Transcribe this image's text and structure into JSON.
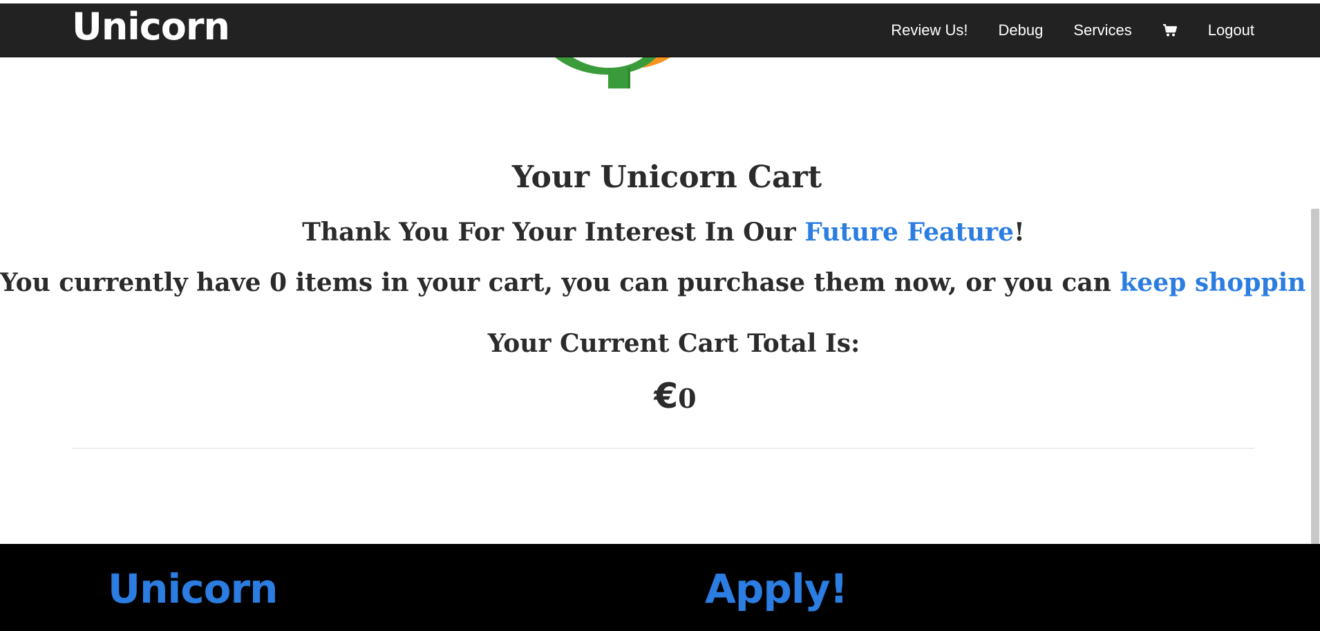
{
  "header": {
    "brand": "Unicorn",
    "nav": {
      "review": "Review Us!",
      "debug": "Debug",
      "services": "Services",
      "cart_icon": "shopping-cart-icon",
      "logout": "Logout"
    }
  },
  "cart": {
    "title": "Your Unicorn Cart",
    "thanks_prefix": "Thank You For Your Interest In Our ",
    "thanks_link": "Future Feature",
    "thanks_suffix": "!",
    "count_prefix": "You currently have 0 items in your cart, you can purchase them now, or you can ",
    "count_link": "keep shopping",
    "count_suffix": ".",
    "total_label": "Your Current Cart Total Is:",
    "currency": "€",
    "total_amount": "0"
  },
  "footer": {
    "brand": "Unicorn",
    "apply": "Apply!"
  },
  "colors": {
    "navbar_bg": "#222222",
    "link": "#2b7de1",
    "footer_bg": "#000000",
    "text": "#2b2b2b"
  }
}
